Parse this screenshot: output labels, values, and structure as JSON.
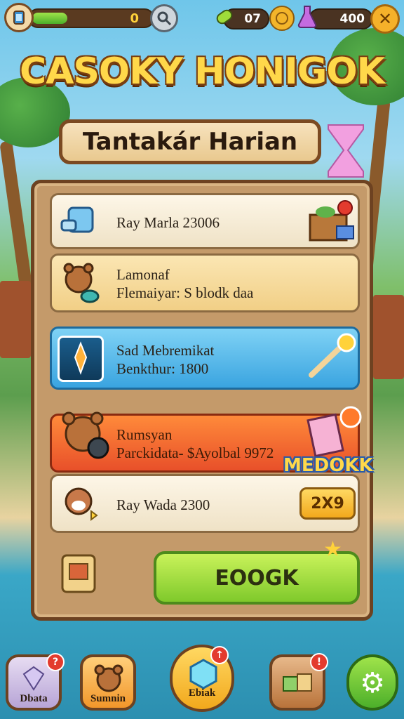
{
  "header": {
    "energy_value": "0",
    "energy_fill": 0.3,
    "gems_value": "07",
    "coins_value": "400"
  },
  "title": {
    "main": "CASOKY HONIGOK",
    "subtitle": "Tantakár Harian"
  },
  "rewards": [
    {
      "line1": "Ray Marla  23006",
      "line2": ""
    },
    {
      "line1": "Lamonaf",
      "line2": "Flemaiyar: S blodk daa"
    },
    {
      "line1": "Sad Mebremikat",
      "line2": "Benkthur: 1800"
    },
    {
      "line1": "Rumsyan",
      "line2": "Parckidata-  $Ayolbal 9972"
    },
    {
      "line1": "Ray Wada  2300",
      "line2": ""
    }
  ],
  "promo_tag": "MEDOKK",
  "multiplier_badge": "2X9",
  "claim_button": "EOOGK",
  "bottom_nav": [
    {
      "label": "Dbata"
    },
    {
      "label": "Sumnin"
    },
    {
      "label": "Ebiak"
    },
    {
      "label": ""
    },
    {
      "label": ""
    }
  ],
  "colors": {
    "accent": "#ffd84a",
    "panel": "#c49a6a",
    "claim": "#7fc92b"
  }
}
